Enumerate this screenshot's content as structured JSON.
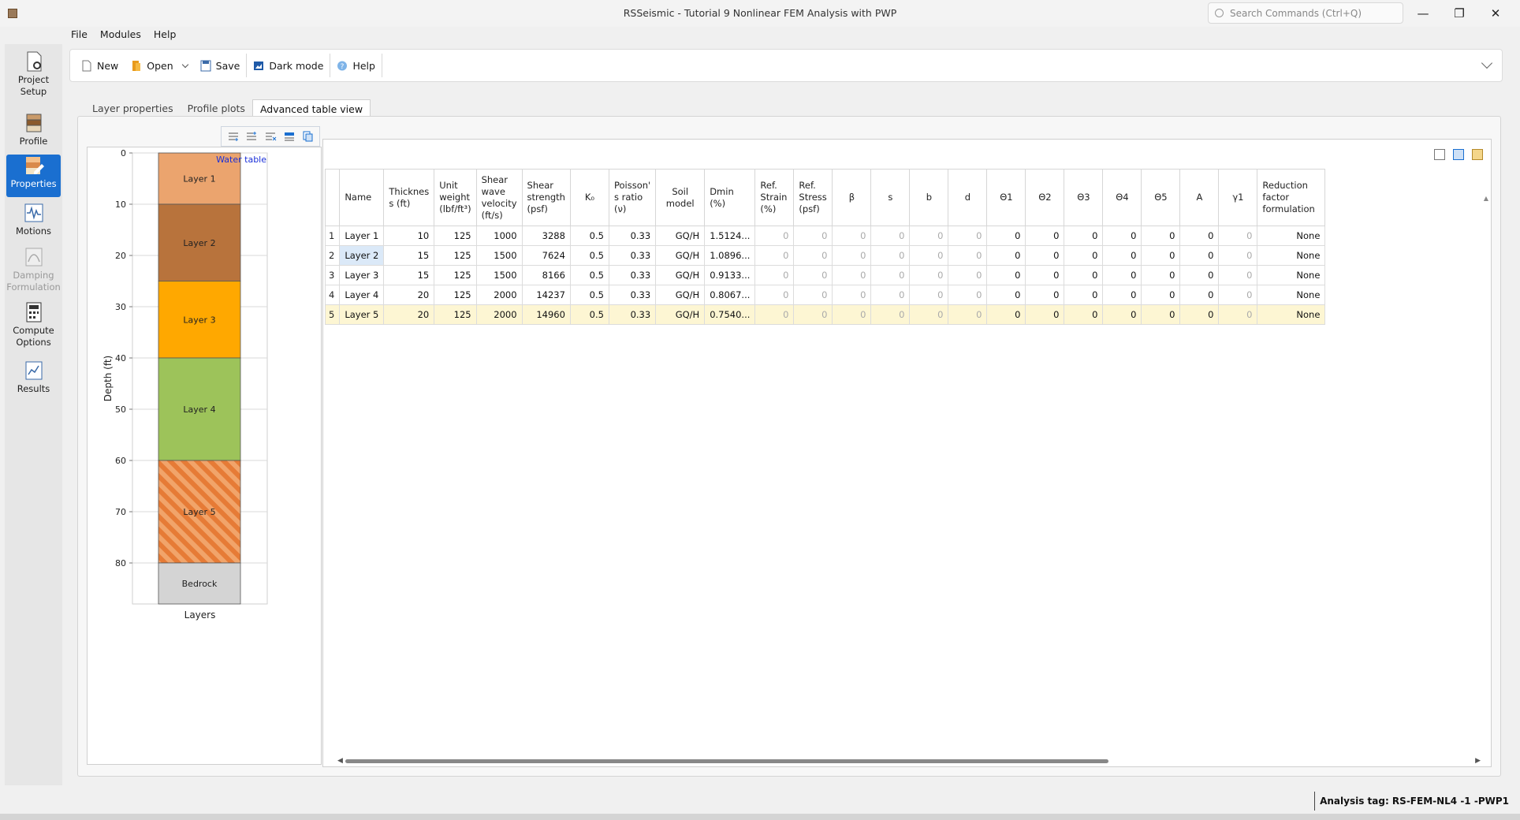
{
  "window": {
    "title": "RSSeismic - Tutorial 9 Nonlinear FEM Analysis with PWP",
    "search_placeholder": "Search Commands (Ctrl+Q)",
    "minimize": "—",
    "restore": "❐",
    "close": "✕"
  },
  "menu": [
    "File",
    "Modules",
    "Help"
  ],
  "toolbar": {
    "new": "New",
    "open": "Open",
    "save": "Save",
    "dark_mode": "Dark mode",
    "help": "Help"
  },
  "left_nav": [
    {
      "label": "Project Setup",
      "state": "normal"
    },
    {
      "label": "Profile",
      "state": "normal"
    },
    {
      "label": "Properties",
      "state": "active"
    },
    {
      "label": "Motions",
      "state": "normal"
    },
    {
      "label": "Damping Formulation",
      "state": "disabled"
    },
    {
      "label": "Compute Options",
      "state": "normal"
    },
    {
      "label": "Results",
      "state": "normal"
    }
  ],
  "tabs": [
    "Layer properties",
    "Profile plots",
    "Advanced table view"
  ],
  "active_tab": 2,
  "profile": {
    "y_axis_label": "Depth (ft)",
    "x_axis_label": "Layers",
    "y_ticks": [
      0,
      10,
      20,
      30,
      40,
      50,
      60,
      70,
      80
    ],
    "y_max": 88,
    "water_table_label": "Water table",
    "layers": [
      {
        "name": "Layer 1",
        "top": 0,
        "bottom": 10,
        "color": "#eba46e",
        "hatch": false
      },
      {
        "name": "Layer 2",
        "top": 10,
        "bottom": 25,
        "color": "#b8733c",
        "hatch": false
      },
      {
        "name": "Layer 3",
        "top": 25,
        "bottom": 40,
        "color": "#ffa800",
        "hatch": false
      },
      {
        "name": "Layer 4",
        "top": 40,
        "bottom": 60,
        "color": "#9dc35a",
        "hatch": false
      },
      {
        "name": "Layer 5",
        "top": 60,
        "bottom": 80,
        "color": "#e67b36",
        "hatch": true
      },
      {
        "name": "Bedrock",
        "top": 80,
        "bottom": 88,
        "color": "#d4d4d4",
        "hatch": false
      }
    ]
  },
  "table": {
    "headers": [
      "",
      "Name",
      "Thicknes s (ft)",
      "Unit weight (lbf/ft³)",
      "Shear wave velocity (ft/s)",
      "Shear strength (psf)",
      "K₀",
      "Poisson' s ratio (ν)",
      "Soil model",
      "Dmin (%)",
      "Ref. Strain (%)",
      "Ref. Stress (psf)",
      "β",
      "s",
      "b",
      "d",
      "Θ1",
      "Θ2",
      "Θ3",
      "Θ4",
      "Θ5",
      "A",
      "γ1",
      "Reduction factor formulation"
    ],
    "rows": [
      [
        "1",
        "Layer 1",
        "10",
        "125",
        "1000",
        "3288",
        "0.5",
        "0.33",
        "GQ/H",
        "1.5124...",
        "0",
        "0",
        "0",
        "0",
        "0",
        "0",
        "0",
        "0",
        "0",
        "0",
        "0",
        "0",
        "0",
        "None"
      ],
      [
        "2",
        "Layer 2",
        "15",
        "125",
        "1500",
        "7624",
        "0.5",
        "0.33",
        "GQ/H",
        "1.0896...",
        "0",
        "0",
        "0",
        "0",
        "0",
        "0",
        "0",
        "0",
        "0",
        "0",
        "0",
        "0",
        "0",
        "None"
      ],
      [
        "3",
        "Layer 3",
        "15",
        "125",
        "1500",
        "8166",
        "0.5",
        "0.33",
        "GQ/H",
        "0.9133...",
        "0",
        "0",
        "0",
        "0",
        "0",
        "0",
        "0",
        "0",
        "0",
        "0",
        "0",
        "0",
        "0",
        "None"
      ],
      [
        "4",
        "Layer 4",
        "20",
        "125",
        "2000",
        "14237",
        "0.5",
        "0.33",
        "GQ/H",
        "0.8067...",
        "0",
        "0",
        "0",
        "0",
        "0",
        "0",
        "0",
        "0",
        "0",
        "0",
        "0",
        "0",
        "0",
        "None"
      ],
      [
        "5",
        "Layer 5",
        "20",
        "125",
        "2000",
        "14960",
        "0.5",
        "0.33",
        "GQ/H",
        "0.7540...",
        "0",
        "0",
        "0",
        "0",
        "0",
        "0",
        "0",
        "0",
        "0",
        "0",
        "0",
        "0",
        "0",
        "None"
      ]
    ],
    "selected_row": 4,
    "selected_name_cell_row": 1
  },
  "status": {
    "analysis_tag": "Analysis tag: RS-FEM-NL4 -1 -PWP1"
  }
}
